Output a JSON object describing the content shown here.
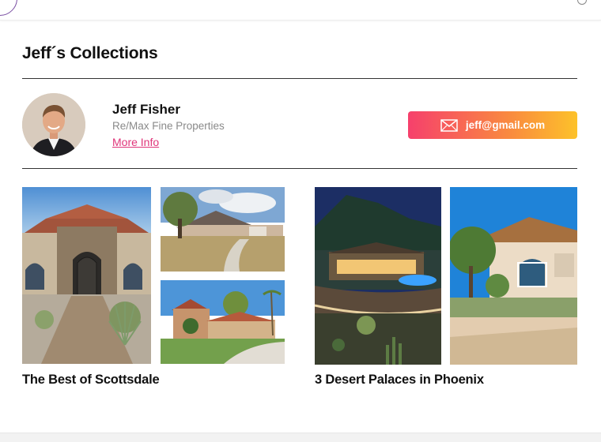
{
  "header": {
    "title": "Jeff´s Collections"
  },
  "agent": {
    "name": "Jeff Fisher",
    "company": "Re/Max Fine Properties",
    "more_info_label": "More Info",
    "email": "jeff@gmail.com"
  },
  "collections": [
    {
      "title": "The Best of Scottsdale",
      "photos": [
        "stone-entry-home-photo",
        "suburban-ranch-home-photo",
        "tile-roof-home-photo"
      ]
    },
    {
      "title": "3 Desert Palaces in Phoenix",
      "photos": [
        "night-hillside-estate-photo",
        "stucco-villa-photo"
      ]
    }
  ],
  "colors": {
    "accent_link": "#e0357a",
    "button_gradient": [
      "#f6406c",
      "#f98a3f",
      "#fdc22a"
    ]
  }
}
